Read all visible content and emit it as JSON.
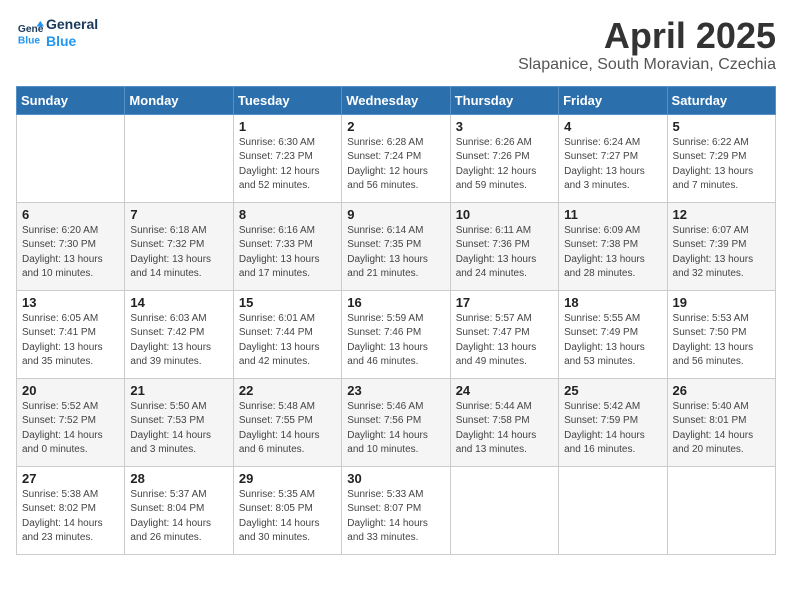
{
  "header": {
    "logo_line1": "General",
    "logo_line2": "Blue",
    "month": "April 2025",
    "location": "Slapanice, South Moravian, Czechia"
  },
  "days_of_week": [
    "Sunday",
    "Monday",
    "Tuesday",
    "Wednesday",
    "Thursday",
    "Friday",
    "Saturday"
  ],
  "weeks": [
    [
      {
        "day": "",
        "detail": ""
      },
      {
        "day": "",
        "detail": ""
      },
      {
        "day": "1",
        "detail": "Sunrise: 6:30 AM\nSunset: 7:23 PM\nDaylight: 12 hours\nand 52 minutes."
      },
      {
        "day": "2",
        "detail": "Sunrise: 6:28 AM\nSunset: 7:24 PM\nDaylight: 12 hours\nand 56 minutes."
      },
      {
        "day": "3",
        "detail": "Sunrise: 6:26 AM\nSunset: 7:26 PM\nDaylight: 12 hours\nand 59 minutes."
      },
      {
        "day": "4",
        "detail": "Sunrise: 6:24 AM\nSunset: 7:27 PM\nDaylight: 13 hours\nand 3 minutes."
      },
      {
        "day": "5",
        "detail": "Sunrise: 6:22 AM\nSunset: 7:29 PM\nDaylight: 13 hours\nand 7 minutes."
      }
    ],
    [
      {
        "day": "6",
        "detail": "Sunrise: 6:20 AM\nSunset: 7:30 PM\nDaylight: 13 hours\nand 10 minutes."
      },
      {
        "day": "7",
        "detail": "Sunrise: 6:18 AM\nSunset: 7:32 PM\nDaylight: 13 hours\nand 14 minutes."
      },
      {
        "day": "8",
        "detail": "Sunrise: 6:16 AM\nSunset: 7:33 PM\nDaylight: 13 hours\nand 17 minutes."
      },
      {
        "day": "9",
        "detail": "Sunrise: 6:14 AM\nSunset: 7:35 PM\nDaylight: 13 hours\nand 21 minutes."
      },
      {
        "day": "10",
        "detail": "Sunrise: 6:11 AM\nSunset: 7:36 PM\nDaylight: 13 hours\nand 24 minutes."
      },
      {
        "day": "11",
        "detail": "Sunrise: 6:09 AM\nSunset: 7:38 PM\nDaylight: 13 hours\nand 28 minutes."
      },
      {
        "day": "12",
        "detail": "Sunrise: 6:07 AM\nSunset: 7:39 PM\nDaylight: 13 hours\nand 32 minutes."
      }
    ],
    [
      {
        "day": "13",
        "detail": "Sunrise: 6:05 AM\nSunset: 7:41 PM\nDaylight: 13 hours\nand 35 minutes."
      },
      {
        "day": "14",
        "detail": "Sunrise: 6:03 AM\nSunset: 7:42 PM\nDaylight: 13 hours\nand 39 minutes."
      },
      {
        "day": "15",
        "detail": "Sunrise: 6:01 AM\nSunset: 7:44 PM\nDaylight: 13 hours\nand 42 minutes."
      },
      {
        "day": "16",
        "detail": "Sunrise: 5:59 AM\nSunset: 7:46 PM\nDaylight: 13 hours\nand 46 minutes."
      },
      {
        "day": "17",
        "detail": "Sunrise: 5:57 AM\nSunset: 7:47 PM\nDaylight: 13 hours\nand 49 minutes."
      },
      {
        "day": "18",
        "detail": "Sunrise: 5:55 AM\nSunset: 7:49 PM\nDaylight: 13 hours\nand 53 minutes."
      },
      {
        "day": "19",
        "detail": "Sunrise: 5:53 AM\nSunset: 7:50 PM\nDaylight: 13 hours\nand 56 minutes."
      }
    ],
    [
      {
        "day": "20",
        "detail": "Sunrise: 5:52 AM\nSunset: 7:52 PM\nDaylight: 14 hours\nand 0 minutes."
      },
      {
        "day": "21",
        "detail": "Sunrise: 5:50 AM\nSunset: 7:53 PM\nDaylight: 14 hours\nand 3 minutes."
      },
      {
        "day": "22",
        "detail": "Sunrise: 5:48 AM\nSunset: 7:55 PM\nDaylight: 14 hours\nand 6 minutes."
      },
      {
        "day": "23",
        "detail": "Sunrise: 5:46 AM\nSunset: 7:56 PM\nDaylight: 14 hours\nand 10 minutes."
      },
      {
        "day": "24",
        "detail": "Sunrise: 5:44 AM\nSunset: 7:58 PM\nDaylight: 14 hours\nand 13 minutes."
      },
      {
        "day": "25",
        "detail": "Sunrise: 5:42 AM\nSunset: 7:59 PM\nDaylight: 14 hours\nand 16 minutes."
      },
      {
        "day": "26",
        "detail": "Sunrise: 5:40 AM\nSunset: 8:01 PM\nDaylight: 14 hours\nand 20 minutes."
      }
    ],
    [
      {
        "day": "27",
        "detail": "Sunrise: 5:38 AM\nSunset: 8:02 PM\nDaylight: 14 hours\nand 23 minutes."
      },
      {
        "day": "28",
        "detail": "Sunrise: 5:37 AM\nSunset: 8:04 PM\nDaylight: 14 hours\nand 26 minutes."
      },
      {
        "day": "29",
        "detail": "Sunrise: 5:35 AM\nSunset: 8:05 PM\nDaylight: 14 hours\nand 30 minutes."
      },
      {
        "day": "30",
        "detail": "Sunrise: 5:33 AM\nSunset: 8:07 PM\nDaylight: 14 hours\nand 33 minutes."
      },
      {
        "day": "",
        "detail": ""
      },
      {
        "day": "",
        "detail": ""
      },
      {
        "day": "",
        "detail": ""
      }
    ]
  ]
}
